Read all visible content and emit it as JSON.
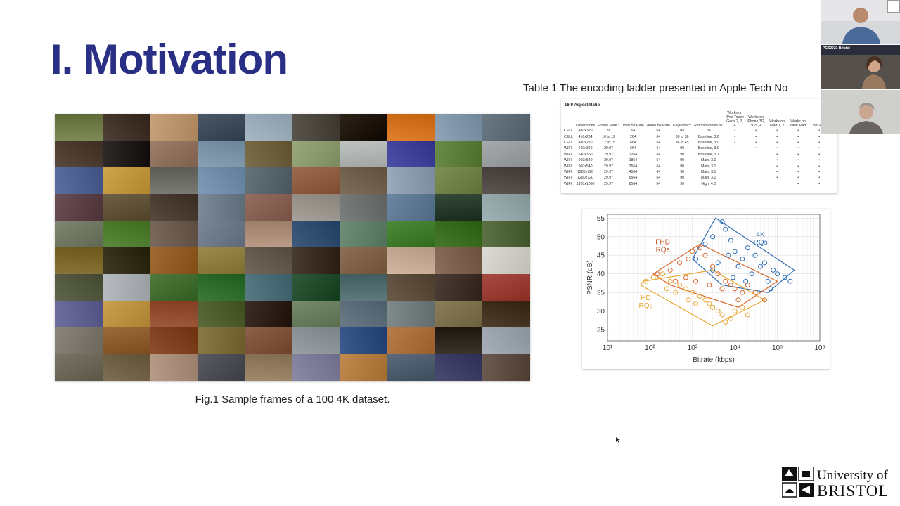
{
  "slide": {
    "title": "I. Motivation",
    "figure_caption": "Fig.1 Sample frames of a 100 4K dataset.",
    "table_caption": "Table 1 The encoding ladder presented in Apple Tech No",
    "logo_line1": "University of",
    "logo_line2": "BRISTOL"
  },
  "mosaic_colors": [
    [
      "#7d8a55",
      "#4d4036",
      "#c9a27a",
      "#4b5968",
      "#a7b8c6",
      "#59544c",
      "#2c2418",
      "#e0802c",
      "#8fa4b7",
      "#6b7a84"
    ],
    [
      "#5a4a3e",
      "#2e2a2a",
      "#9c7e6a",
      "#8aa2b6",
      "#7c6e4a",
      "#9aa87e",
      "#bfc3c2",
      "#4d4fa7",
      "#6b8b49",
      "#a7abad"
    ],
    [
      "#5d6fa0",
      "#cfa44b",
      "#7a7a74",
      "#7e9bb8",
      "#66737a",
      "#9c6a4e",
      "#7e6d5a",
      "#9ba9bd",
      "#7d8f54",
      "#5e5552"
    ],
    [
      "#6a4f55",
      "#6e6044",
      "#584940",
      "#7c8a98",
      "#946e60",
      "#a6a29a",
      "#7a7e7c",
      "#6a86a0",
      "#35483a",
      "#9fb3b6"
    ],
    [
      "#7d8670",
      "#5c8a3c",
      "#7b6a5e",
      "#7b8797",
      "#b99b86",
      "#3e5a7c",
      "#6f8e78",
      "#4d8a3a",
      "#46782e",
      "#5c7245"
    ],
    [
      "#8a7538",
      "#3f3a25",
      "#a06a33",
      "#9b8a4e",
      "#72675a",
      "#473a30",
      "#8d6f55",
      "#d4b7a2",
      "#8a6e5c",
      "#dcdcd4"
    ],
    [
      "#60664e",
      "#b7bcc0",
      "#4f7a3e",
      "#3b7a3a",
      "#587a84",
      "#2f5a3a",
      "#5f7a7c",
      "#6a5a4a",
      "#4a3e36",
      "#a64a42"
    ],
    [
      "#6e6fa0",
      "#c8a050",
      "#a05a3e",
      "#5b6b3a",
      "#3a2e26",
      "#768a6c",
      "#6a7a86",
      "#7f8a8a",
      "#8a7e5a",
      "#4f3e2c"
    ],
    [
      "#8a857a",
      "#9b6a3c",
      "#8d4e2e",
      "#8a7a48",
      "#8a6048",
      "#9aa0a6",
      "#3c5a8c",
      "#b87c4a",
      "#3b342c",
      "#a7b0b8"
    ],
    [
      "#7a7466",
      "#7e6e54",
      "#b89c8a",
      "#5a5a62",
      "#a08a6e",
      "#8a8aa6",
      "#c08a4e",
      "#5a6a7a",
      "#4a4a72",
      "#6a5a50"
    ]
  ],
  "table": {
    "title": "16:9 Aspect Ratio",
    "headers": [
      "",
      "Dimensions",
      "Frame Rate *",
      "Total Bit Rate",
      "Audio Bit Rate",
      "Keyframe**",
      "Restrict Profile to:",
      "Works on iPod Touch Gens 2, 3, 4",
      "Works on iPhone 3G, 3GS, 4",
      "Works on iPad 1, 2",
      "Works on New iPad",
      "Wo App"
    ],
    "rows": [
      [
        "CELL",
        "480x320",
        "na",
        "64",
        "64",
        "na",
        "na",
        "•",
        "•",
        "•",
        "•",
        "•"
      ],
      [
        "CELL",
        "416x234",
        "10 to 12",
        "264",
        "64",
        "30 to 36",
        "Baseline, 3.0",
        "•",
        "•",
        "•",
        "•",
        "•"
      ],
      [
        "CELL",
        "480x270",
        "12 to 15",
        "464",
        "64",
        "36 to 45",
        "Baseline, 3.0",
        "•",
        "•",
        "•",
        "•",
        "•"
      ],
      [
        "WIFI",
        "640x360",
        "29.97",
        "664",
        "64",
        "90",
        "Baseline, 3.0",
        "•",
        "•",
        "•",
        "•",
        "•"
      ],
      [
        "WIFI",
        "640x360",
        "29.97",
        "1264",
        "64",
        "90",
        "Baseline, 3.1",
        "",
        "",
        "•",
        "•",
        "•"
      ],
      [
        "WIFI",
        "960x540",
        "29.97",
        "1864",
        "64",
        "90",
        "Main, 3.1",
        "",
        "",
        "•",
        "•",
        "•"
      ],
      [
        "WIFI",
        "960x540",
        "29.97",
        "2564",
        "64",
        "90",
        "Main, 3.1",
        "",
        "",
        "•",
        "•",
        "•"
      ],
      [
        "WIFI",
        "1280x720",
        "29.97",
        "4564",
        "64",
        "90",
        "Main, 3.1",
        "",
        "",
        "•",
        "•",
        "•"
      ],
      [
        "WIFI",
        "1280x720",
        "29.97",
        "6564",
        "64",
        "90",
        "Main, 3.1",
        "",
        "",
        "•",
        "•",
        "•"
      ],
      [
        "WIFI",
        "1920x1080",
        "29.97",
        "8564",
        "64",
        "90",
        "High, 4.0",
        "",
        "",
        "",
        "•",
        "•"
      ]
    ]
  },
  "chart_data": {
    "type": "scatter",
    "title": "",
    "xlabel": "Bitrate (kbps)",
    "ylabel": "PSNR (dB)",
    "xscale": "log",
    "xlim": [
      10,
      1000000
    ],
    "ylim": [
      22,
      56
    ],
    "yticks": [
      25,
      30,
      35,
      40,
      45,
      50,
      55
    ],
    "xtick_labels": [
      "10¹",
      "10²",
      "10³",
      "10⁴",
      "10⁵",
      "10⁶"
    ],
    "grid": true,
    "series": [
      {
        "name": "4K RQs",
        "color": "#2f6db5",
        "points": [
          [
            1200,
            44
          ],
          [
            2000,
            48
          ],
          [
            3000,
            50
          ],
          [
            5000,
            54
          ],
          [
            6000,
            52
          ],
          [
            8000,
            49
          ],
          [
            10000,
            46
          ],
          [
            15000,
            44
          ],
          [
            20000,
            47
          ],
          [
            30000,
            45
          ],
          [
            50000,
            43
          ],
          [
            80000,
            41
          ],
          [
            100000,
            40
          ],
          [
            150000,
            39
          ],
          [
            200000,
            38
          ],
          [
            40000,
            42
          ],
          [
            25000,
            40
          ],
          [
            12000,
            42
          ],
          [
            7000,
            45
          ],
          [
            4000,
            43
          ],
          [
            3000,
            41
          ],
          [
            60000,
            38
          ],
          [
            70000,
            36
          ],
          [
            9000,
            39
          ],
          [
            18000,
            38
          ]
        ]
      },
      {
        "name": "FHD RQs",
        "color": "#d8672a",
        "points": [
          [
            150,
            40
          ],
          [
            300,
            41
          ],
          [
            500,
            43
          ],
          [
            800,
            44
          ],
          [
            1000,
            46
          ],
          [
            1500,
            47
          ],
          [
            2000,
            45
          ],
          [
            3000,
            42
          ],
          [
            4000,
            40
          ],
          [
            6000,
            38
          ],
          [
            8000,
            37
          ],
          [
            10000,
            36
          ],
          [
            15000,
            35
          ],
          [
            20000,
            37
          ],
          [
            30000,
            35
          ],
          [
            50000,
            33
          ],
          [
            1200,
            38
          ],
          [
            700,
            39
          ],
          [
            2500,
            37
          ],
          [
            5000,
            36
          ],
          [
            12000,
            33
          ],
          [
            400,
            38
          ]
        ]
      },
      {
        "name": "HD RQs",
        "color": "#e8a632",
        "points": [
          [
            80,
            38
          ],
          [
            120,
            39
          ],
          [
            200,
            40
          ],
          [
            300,
            38
          ],
          [
            500,
            37
          ],
          [
            700,
            36
          ],
          [
            1000,
            35
          ],
          [
            1500,
            34
          ],
          [
            2000,
            33
          ],
          [
            3000,
            31
          ],
          [
            4000,
            30
          ],
          [
            5000,
            29
          ],
          [
            8000,
            28
          ],
          [
            10000,
            30
          ],
          [
            15000,
            31
          ],
          [
            20000,
            29
          ],
          [
            800,
            33
          ],
          [
            400,
            35
          ],
          [
            250,
            36
          ],
          [
            2500,
            32
          ],
          [
            6000,
            27
          ],
          [
            1200,
            32
          ]
        ]
      }
    ],
    "annotations": [
      {
        "text": "4K",
        "text2": "RQs",
        "color": "#2f6db5"
      },
      {
        "text": "FHD",
        "text2": "RQs",
        "color": "#c9582a"
      },
      {
        "text": "HD",
        "text2": "RQs",
        "color": "#e8a632"
      }
    ]
  },
  "participants": [
    {
      "name_tag": ""
    },
    {
      "name_tag": "PCS2021 Bristol"
    },
    {
      "name_tag": ""
    }
  ]
}
